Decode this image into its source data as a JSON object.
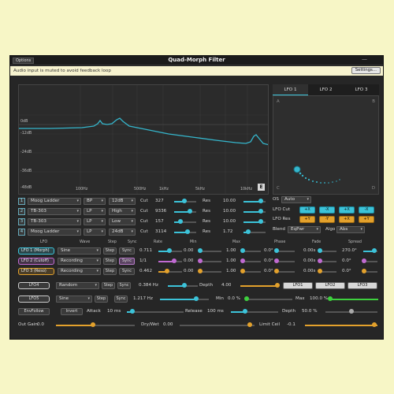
{
  "window": {
    "options_label": "Options",
    "title": "Quad-Morph Filter",
    "close_glyph": "—",
    "notice": "Audio input is muted to avoid feedback loop",
    "settings_label": "Settings..."
  },
  "display": {
    "db_label": "0dB",
    "left_labels": [
      "-12dB",
      "-24dB",
      "-36dB",
      "-48dB"
    ],
    "freq_labels": [
      "100Hz",
      "500Hz",
      "1kHz",
      "5kHz",
      "10kHz"
    ],
    "e_label": "E"
  },
  "lfo_tabs": [
    "LFO 1",
    "LFO 2",
    "LFO 3"
  ],
  "xy_corners": {
    "a": "A",
    "b": "B",
    "c": "C",
    "d": "D"
  },
  "filters": [
    {
      "num": "1",
      "type": "Moog Ladder",
      "mode": "BP",
      "slope": "12dB",
      "cut_label": "Cut",
      "cut": "327",
      "res_label": "Res",
      "res": "10.00",
      "cut_pos": 0.45,
      "res_pos": 0.8
    },
    {
      "num": "2",
      "type": "TB-303",
      "mode": "LP",
      "slope": "High",
      "cut_label": "Cut",
      "cut": "9336",
      "res_label": "Res",
      "res": "10.00",
      "cut_pos": 0.72,
      "res_pos": 0.8
    },
    {
      "num": "3",
      "type": "TB-303",
      "mode": "LP",
      "slope": "Low",
      "cut_label": "Cut",
      "cut": "157",
      "res_label": "Res",
      "res": "10.00",
      "cut_pos": 0.3,
      "res_pos": 0.8
    },
    {
      "num": "4",
      "type": "Moog Ladder",
      "mode": "LP",
      "slope": "24dB",
      "cut_label": "Cut",
      "cut": "3114",
      "res_label": "Res",
      "res": "1.72",
      "cut_pos": 0.6,
      "res_pos": 0.2
    }
  ],
  "right_controls": {
    "os_label": "OS",
    "os_value": "Auto",
    "lfo_cut_label": "LFO Cut",
    "lfo_res_label": "LFO Res",
    "cut_buttons": [
      "+X",
      "-X",
      "+X",
      "-X"
    ],
    "res_buttons": [
      "+Y",
      "-Y",
      "+X",
      "+Y"
    ],
    "blend_label": "Blend",
    "blend_value": "EqPwr",
    "algo_label": "Algo",
    "algo_value": "Abs"
  },
  "lfo_table": {
    "headers": [
      "LFO",
      "Wave",
      "Step",
      "Sync",
      "Rate",
      "Min",
      "Max",
      "Phase",
      "Fade",
      "Spread"
    ],
    "rows": [
      {
        "name": "LFO 1 (Morph)",
        "wave": "Sine",
        "step": "Step",
        "sync": "Sync",
        "rate": "0.711",
        "min": "0.00",
        "max": "1.00",
        "phase": "0.0°",
        "fade": "0.00s",
        "spread": "270.0°",
        "color": "#3cc3d9"
      },
      {
        "name": "LFO 2 (Cutoff)",
        "wave": "Recording",
        "step": "Step",
        "sync": "Sync",
        "rate": "1/1",
        "min": "0.00",
        "max": "1.00",
        "phase": "0.0°",
        "fade": "0.00s",
        "spread": "0.0°",
        "color": "#c06ad1"
      },
      {
        "name": "LFO 3 (Reso)",
        "wave": "Recording",
        "step": "Step",
        "sync": "Sync",
        "rate": "0.462",
        "min": "0.00",
        "max": "1.00",
        "phase": "0.0°",
        "fade": "0.00s",
        "spread": "0.0°",
        "color": "#e3a12c"
      }
    ]
  },
  "lfo4": {
    "name": "LFO4",
    "wave": "Random",
    "step": "Step",
    "sync": "Sync",
    "rate": "0.384 Hz",
    "depth_label": "Depth",
    "depth": "4.00",
    "targets": [
      "LFO1",
      "LFO2",
      "LFO3"
    ]
  },
  "lfo5": {
    "name": "LFO5",
    "wave": "Sine",
    "step": "Step",
    "sync": "Sync",
    "rate": "1.217 Hz",
    "min_label": "Min",
    "min": "0.0 %",
    "max_label": "Max",
    "max": "100.0 %"
  },
  "envfollow": {
    "name": "EnvFollow",
    "invert": "Invert",
    "attack_label": "Attack",
    "attack": "10 ms",
    "release_label": "Release",
    "release": "100 ms",
    "depth_label": "Depth",
    "depth": "50.0 %"
  },
  "bottom": {
    "gain_label": "Out Gain",
    "gain": "0.0",
    "drywet_label": "Dry/Wet",
    "drywet": "0.00",
    "limit_label": "Limit Ceil",
    "limit": "-0.1"
  },
  "colors": {
    "cyan": "#3cc3d9",
    "purple": "#c06ad1",
    "orange": "#e3a12c",
    "green": "#3ed13e",
    "curve": "#35b6cc"
  }
}
